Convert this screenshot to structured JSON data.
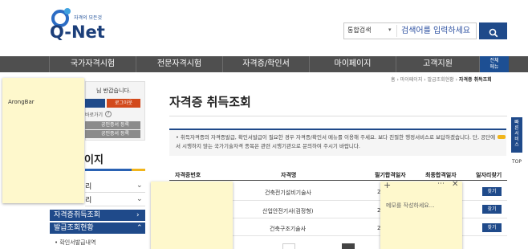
{
  "header": {
    "logo_slogan": "자격의 모든것",
    "logo_text": "Q-Net",
    "search": {
      "category": "통합검색",
      "placeholder": "검색어를 입력하세요"
    }
  },
  "gnb": {
    "items": [
      "국가자격시험",
      "전문자격시험",
      "자격증/학인서",
      "마이페이지",
      "고객지원"
    ],
    "all_menu": [
      "전체",
      "메뉴"
    ]
  },
  "notes": {
    "left_label": "ArongBar",
    "memo_placeholder": "메모를 작성하세요..."
  },
  "left": {
    "welcome": "님 반갑습니다.",
    "logout": "로그아웃",
    "shortcut": "바로가기",
    "grey_buttons": [
      "공인증서 등록",
      "공인증서 등록"
    ],
    "section_title": "이지",
    "lnb": [
      {
        "label": "리"
      },
      {
        "label": "리"
      }
    ],
    "active_items": [
      "자격증취득조회",
      "발급조회현황"
    ],
    "sub_item": "• 확인서발급내역"
  },
  "main": {
    "breadcrumb": [
      "홈",
      "마이페이지",
      "발급조회현황",
      "자격증 취득조회"
    ],
    "title": "자격증 취득조회",
    "notice": "• 취득자격증의 자격증발급, 확인서발급이 필요한 경우 자격증/확인서 메뉴를 이용해 주세요. 보다 친절한 행정서비스로 보답하겠습니다. 단, 공단에서 시행하지 않는 국가기술자격 종목은 관련 시행기관으로 문의하여 주시기 바랍니다.",
    "table": {
      "headers": [
        "자격증번호",
        "자격명",
        "필기합격일자",
        "최종합격일자",
        "일자리찾기"
      ],
      "rows": [
        {
          "name": "건축전기설비기술사",
          "written": "2",
          "action": "찾기"
        },
        {
          "name": "산업안전기사(검정형)",
          "written": "2",
          "action": "찾기"
        },
        {
          "name": "건축구조기술사",
          "written": "2",
          "action": "찾기"
        }
      ]
    }
  },
  "quick": {
    "label": [
      "빠",
      "른",
      "서",
      "비",
      "스"
    ],
    "top": "TOP"
  }
}
